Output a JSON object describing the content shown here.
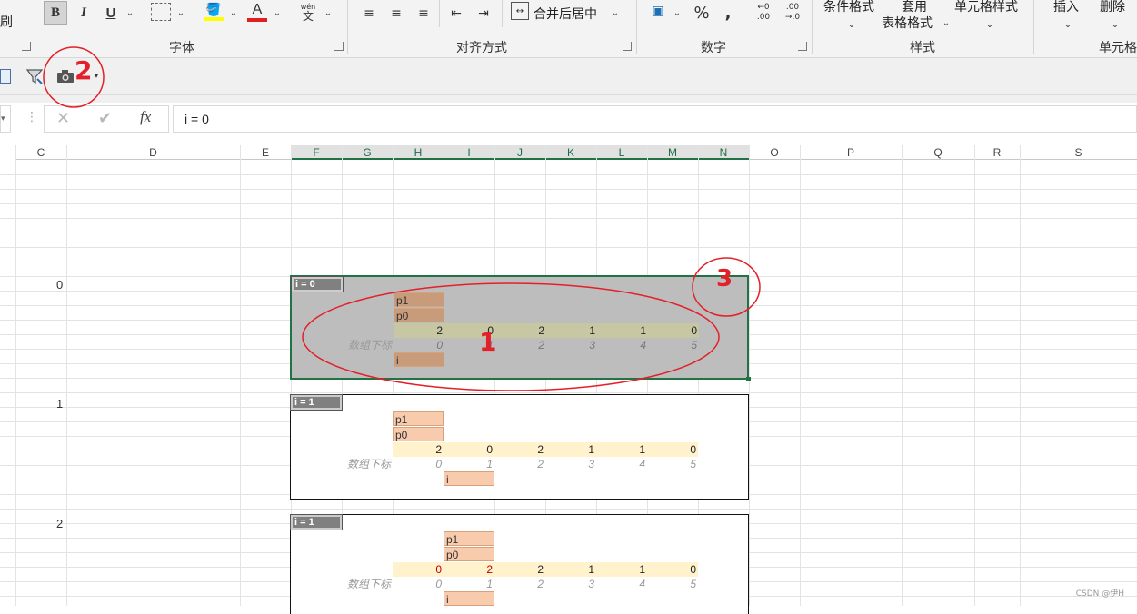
{
  "ribbon": {
    "left_fragment": "刷",
    "bold": "B",
    "italic": "I",
    "underline": "U",
    "font_color_glyph": "A",
    "phonetic_top": "wén",
    "phonetic_bottom": "文",
    "merge_center": "合并后居中",
    "percent": "%",
    "comma": ",",
    "dec_inc_top": "←0",
    "dec_inc_bottom": ".00",
    "dec_dec_top": ".00",
    "dec_dec_bottom": "→.0",
    "cond_format": "条件格式",
    "apply_top": "套用",
    "table_format": "表格格式",
    "cell_style": "单元格样式",
    "insert": "插入",
    "delete": "删除",
    "groups": {
      "font": "字体",
      "align": "对齐方式",
      "number": "数字",
      "styles": "样式",
      "cells": "单元格"
    }
  },
  "formula_bar": {
    "cancel": "✕",
    "enter": "✔",
    "fx": "fx",
    "value": "i = 0"
  },
  "columns": [
    "C",
    "D",
    "E",
    "F",
    "G",
    "H",
    "I",
    "J",
    "K",
    "L",
    "M",
    "N",
    "O",
    "P",
    "Q",
    "R",
    "S"
  ],
  "row_labels": [
    "0",
    "1",
    "2"
  ],
  "blocks": [
    {
      "tag": "i = 0",
      "p1": "p1",
      "p0": "p0",
      "values": [
        "2",
        "0",
        "2",
        "1",
        "1",
        "0"
      ],
      "index_label": "数组下标",
      "indices": [
        "0",
        "1",
        "2",
        "3",
        "4",
        "5"
      ],
      "i_label": "i"
    },
    {
      "tag": "i = 1",
      "p1": "p1",
      "p0": "p0",
      "values": [
        "2",
        "0",
        "2",
        "1",
        "1",
        "0"
      ],
      "index_label": "数组下标",
      "indices": [
        "0",
        "1",
        "2",
        "3",
        "4",
        "5"
      ],
      "i_label": "i"
    },
    {
      "tag": "i = 1",
      "p1": "p1",
      "p0": "p0",
      "values": [
        "0",
        "2",
        "2",
        "1",
        "1",
        "0"
      ],
      "index_label": "数组下标",
      "indices": [
        "0",
        "1",
        "2",
        "3",
        "4",
        "5"
      ],
      "i_label": "i"
    }
  ],
  "annotations": {
    "one": "1",
    "two": "2",
    "three": "3",
    "color": "#e3202a"
  },
  "colors": {
    "pointer_fill": "#f8cbad",
    "value_fill": "#fff2cc",
    "selection_border": "#217346",
    "tag_fill": "#808080"
  },
  "watermark": "CSDN @伊H"
}
